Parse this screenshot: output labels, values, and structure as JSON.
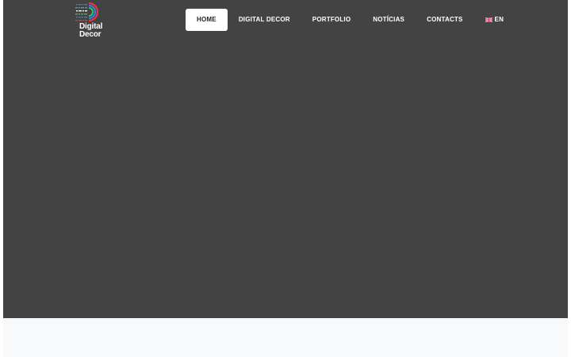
{
  "brand": {
    "line1": "Digital",
    "line2": "Decor",
    "logo_icon": "digital-decor-logo-icon",
    "colors": {
      "red": "#e8383d",
      "blue": "#3b7dd8",
      "green": "#3bb873",
      "white": "#ffffff"
    }
  },
  "nav": {
    "items": [
      {
        "label": "HOME",
        "active": true
      },
      {
        "label": "DIGITAL DECOR"
      },
      {
        "label": "PORTFOLIO"
      },
      {
        "label": "NOTÍCIAS"
      },
      {
        "label": "CONTACTS"
      }
    ],
    "language": {
      "label": "EN",
      "icon": "uk-flag-icon"
    }
  },
  "theme": {
    "hero_background": "#434343",
    "footer_background": "#f8f9fb"
  }
}
